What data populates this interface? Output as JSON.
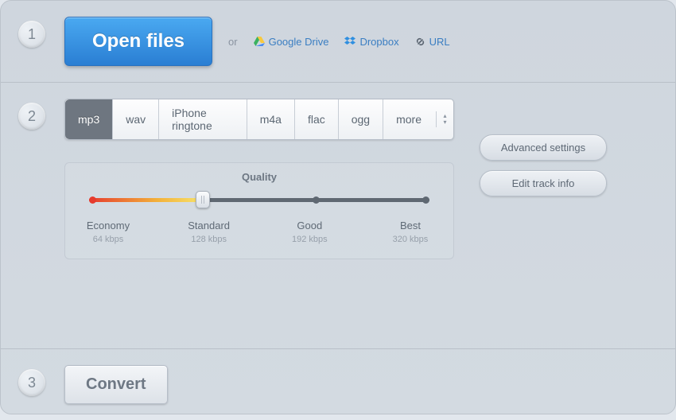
{
  "step1": {
    "open_label": "Open files",
    "or": "or",
    "gdrive": "Google Drive",
    "dropbox": "Dropbox",
    "url": "URL"
  },
  "step2": {
    "formats": [
      "mp3",
      "wav",
      "iPhone ringtone",
      "m4a",
      "flac",
      "ogg",
      "more"
    ],
    "active_format_index": 0,
    "quality_title": "Quality",
    "levels": [
      {
        "name": "Economy",
        "bitrate": "64 kbps"
      },
      {
        "name": "Standard",
        "bitrate": "128 kbps"
      },
      {
        "name": "Good",
        "bitrate": "192 kbps"
      },
      {
        "name": "Best",
        "bitrate": "320 kbps"
      }
    ],
    "selected_level_index": 1,
    "advanced_label": "Advanced settings",
    "edit_track_label": "Edit track info"
  },
  "step3": {
    "convert_label": "Convert"
  },
  "badges": {
    "one": "1",
    "two": "2",
    "three": "3"
  }
}
